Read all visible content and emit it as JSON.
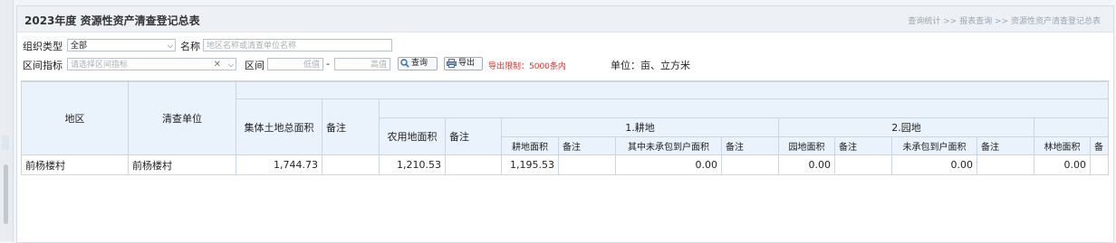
{
  "title": "2023年度 资源性资产清查登记总表",
  "breadcrumb": "查询统计 >> 报表查询 >> 资源性资产清查登记总表",
  "filters": {
    "org_type_label": "组织类型",
    "org_type_value": "全部",
    "name_label": "名称",
    "name_placeholder": "地区名称或清查单位名称",
    "range_indicator_label": "区间指标",
    "range_indicator_placeholder": "请选择区间指标",
    "range_label": "区间",
    "low_placeholder": "低值",
    "dash": "-",
    "high_placeholder": "高值",
    "query_label": "查询",
    "export_label": "导出",
    "export_limit": "导出限制：5000条内",
    "unit": "单位：亩、立方米"
  },
  "table": {
    "headers": {
      "region": "地区",
      "unit": "清查单位",
      "collective_land_total": "集体土地总面积",
      "remark": "备注",
      "agri_land_area": "农用地面积",
      "group_cultivated": "1.耕地",
      "group_garden": "2.园地",
      "cultivated_area": "耕地面积",
      "uncontracted_area": "其中未承包到户面积",
      "garden_area": "园地面积",
      "garden_uncontracted": "未承包到户面积",
      "forest_area": "林地面积",
      "partial_remark": "备"
    },
    "rows": [
      {
        "region": "前杨楼村",
        "unit": "前杨楼村",
        "collective_land_total": "1,744.73",
        "remark1": "",
        "agri_land_area": "1,210.53",
        "remark2": "",
        "cultivated_area": "1,195.53",
        "remark3": "",
        "uncontracted_area": "0.00",
        "remark4": "",
        "garden_area": "0.00",
        "remark5": "",
        "garden_uncontracted": "0.00",
        "remark6": "",
        "forest_area": "0.00",
        "remark7": ""
      }
    ]
  }
}
